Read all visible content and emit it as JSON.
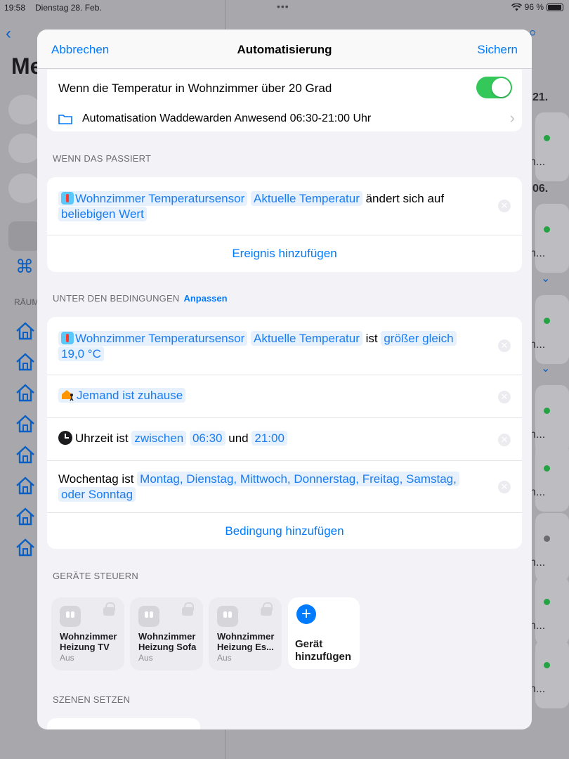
{
  "status": {
    "time": "19:58",
    "date": "Dienstag 28. Feb.",
    "battery": "96 %"
  },
  "background": {
    "title": "Me",
    "section": "RÄUM",
    "right_cards": [
      {
        "text": "n...",
        "dot": "#34c759"
      },
      {
        "text": "n...",
        "dot": "#34c759"
      },
      {
        "text": "n...",
        "dot": "#34c759"
      },
      {
        "text": "n...",
        "dot": "#34c759"
      },
      {
        "text": "n...",
        "dot": "#34c759"
      },
      {
        "text": "n...",
        "dot": "#8e8e93"
      },
      {
        "text": "n...",
        "dot": "#34c759"
      },
      {
        "text": "n...",
        "dot": "#34c759"
      }
    ],
    "right_labels": [
      "21.",
      "06."
    ]
  },
  "nav": {
    "cancel": "Abbrechen",
    "title": "Automatisierung",
    "save": "Sichern"
  },
  "header_card": {
    "title": "Wenn die Temperatur in Wohnzimmer über 20 Grad",
    "enabled": true,
    "folder": "Automatisation Waddewarden Anwesend 06:30-21:00 Uhr"
  },
  "trigger": {
    "section": "WENN DAS PASSIERT",
    "sensor": "Wohnzimmer Temperatursensor",
    "characteristic": "Aktuelle Temperatur",
    "verb": "ändert sich auf",
    "value": "beliebigen Wert",
    "add": "Ereignis hinzufügen"
  },
  "conditions": {
    "section": "UNTER DEN BEDINGUNGEN",
    "customize": "Anpassen",
    "temp": {
      "sensor": "Wohnzimmer Temperatursensor",
      "characteristic": "Aktuelle Temperatur",
      "verb": "ist",
      "operator": "größer gleich",
      "value": "19,0 °C"
    },
    "presence": "Jemand ist zuhause",
    "time": {
      "prefix": "Uhrzeit ist",
      "mode": "zwischen",
      "start": "06:30",
      "and": "und",
      "end": "21:00"
    },
    "weekday": {
      "prefix": "Wochentag ist",
      "days": "Montag, Dienstag, Mittwoch, Donnerstag, Freitag, Samstag, oder Sonntag"
    },
    "add": "Bedingung hinzufügen"
  },
  "devices": {
    "section": "GERÄTE STEUERN",
    "items": [
      {
        "name": "Wohnzimmer Heizung TV",
        "state": "Aus"
      },
      {
        "name": "Wohnzimmer Heizung Sofa",
        "state": "Aus"
      },
      {
        "name": "Wohnzimmer Heizung Es...",
        "state": "Aus"
      }
    ],
    "add": "Gerät hinzufügen"
  },
  "scenes": {
    "section": "SZENEN SETZEN"
  }
}
